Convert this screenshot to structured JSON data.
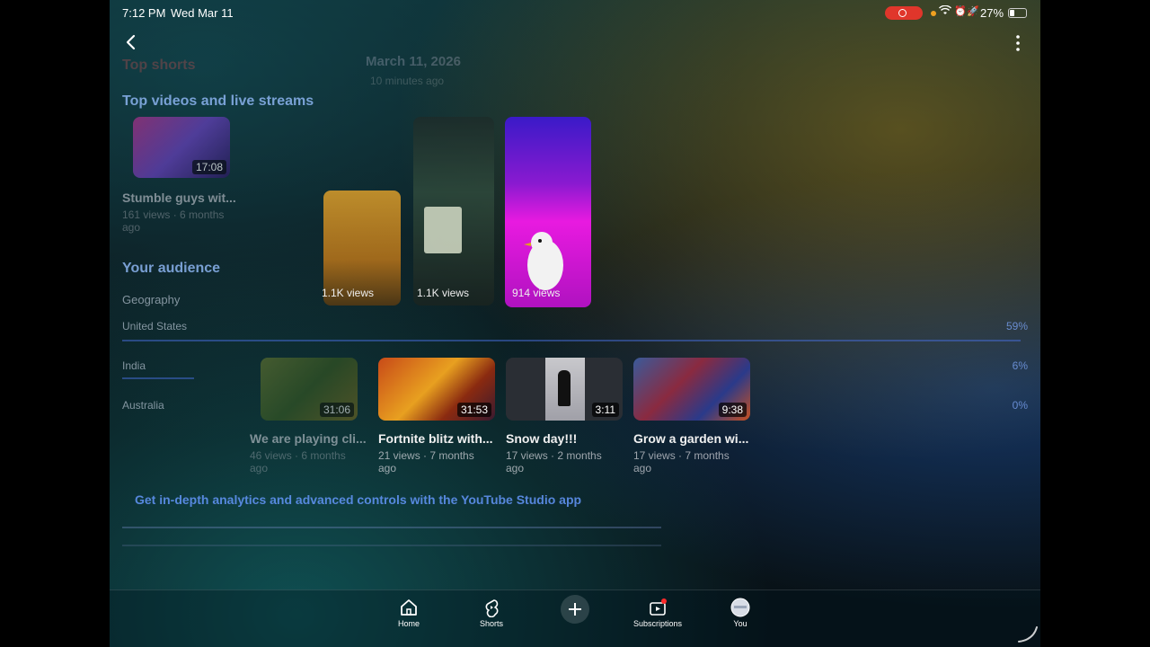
{
  "status": {
    "time": "7:12 PM",
    "date": "Wed Mar 11",
    "battery": "27%"
  },
  "ghost_header": {
    "date": "March 11, 2026",
    "ago": "10 minutes ago",
    "top_shorts": "Top shorts"
  },
  "sections": {
    "top_videos": "Top videos and live streams",
    "your_audience": "Your audience",
    "geography": "Geography"
  },
  "geography": [
    {
      "country": "United States",
      "pct": "59%"
    },
    {
      "country": "India",
      "pct": "6%"
    },
    {
      "country": "Australia",
      "pct": "0%"
    }
  ],
  "shorts": [
    {
      "views": "1.1K views"
    },
    {
      "views": "1.1K views"
    },
    {
      "views": "914 views"
    }
  ],
  "videos": [
    {
      "title": "We are playing cli...",
      "meta": "46 views · 6 months ago",
      "duration": "31:06"
    },
    {
      "title": "Fortnite blitz with...",
      "meta": "21 views · 7 months ago",
      "duration": "31:53"
    },
    {
      "title": "Snow day!!!",
      "meta": "17 views · 2 months ago",
      "duration": "3:11"
    },
    {
      "title": "Grow a garden wi...",
      "meta": "17 views · 7 months ago",
      "duration": "9:38"
    }
  ],
  "ghost_video": {
    "title": "Stumble guys wit...",
    "meta": "161 views · 6 months ago",
    "duration": "17:08"
  },
  "banner": "Get in-depth analytics and advanced controls with the YouTube Studio app",
  "nav": {
    "home": "Home",
    "shorts": "Shorts",
    "subscriptions": "Subscriptions",
    "you": "You"
  },
  "colors": {
    "accent_blue": "#6496fa",
    "record_red": "#e0362b",
    "notification_red": "#ff2a2a"
  }
}
